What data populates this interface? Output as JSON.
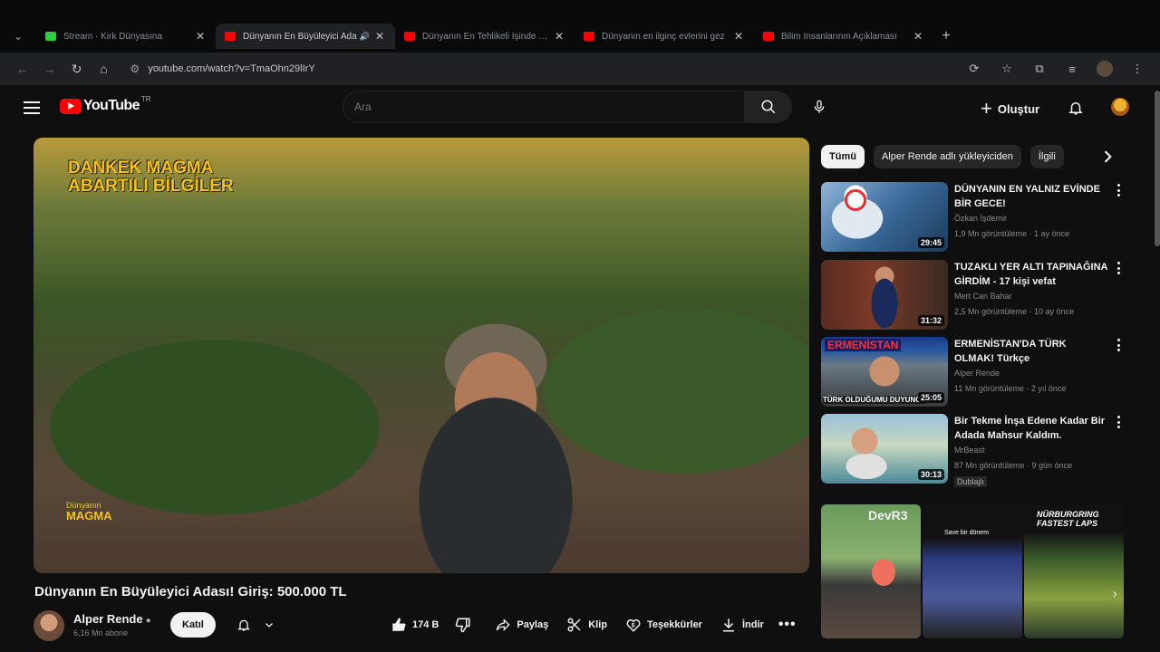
{
  "browser": {
    "tabs": [
      {
        "title": "Stream · Kirk Dünyasına",
        "active": false,
        "favicon_color": "#2ecc40"
      },
      {
        "title": "Dünyanın En Büyüleyici Ada",
        "active": true,
        "favicon_color": "#ff0000"
      },
      {
        "title": "Dünyanın En Tehlikeli İşinde Bir Gün",
        "active": false,
        "favicon_color": "#ff0000"
      },
      {
        "title": "Dünyanın en ilginç evlerini gez",
        "active": false,
        "favicon_color": "#ff0000"
      },
      {
        "title": "Bilim İnsanlarının Açıklaması",
        "active": false,
        "favicon_color": "#ff0000"
      }
    ],
    "url": "youtube.com/watch?v=TmaOhn29lIrY"
  },
  "header": {
    "logo_text": "YouTube",
    "country_code": "TR",
    "search_placeholder": "Ara",
    "create_label": "Oluştur"
  },
  "video": {
    "overlay_title_line1": "DANKEK MAGMA",
    "overlay_title_line2": "ABARTILI BİLGİLER",
    "overlay_caption_top": "Dünyanın",
    "overlay_caption_bottom": "MAGMA",
    "title": "Dünyanın En Büyüleyici Adası! Giriş: 500.000 TL"
  },
  "channel": {
    "name": "Alper Rende",
    "subscribers": "6,16 Mn abone",
    "join_label": "Katıl"
  },
  "actions": {
    "likes": "174 B",
    "share_label": "Paylaş",
    "clip_label": "Klip",
    "thanks_label": "Teşekkürler",
    "download_label": "İndir"
  },
  "chips": [
    "Tümü",
    "Alper Rende adlı yükleyiciden",
    "İlgili"
  ],
  "recommendations": [
    {
      "title": "DÜNYANIN EN YALNIZ EVİNDE BİR GECE!",
      "channel": "Özkan İşdemir",
      "meta": "1,9 Mn görüntüleme · 1 ay önce",
      "duration": "29:45",
      "dubbed": ""
    },
    {
      "title": "TUZAKLI YER ALTI TAPINAĞINA GİRDİM - 17 kişi vefat",
      "channel": "Mert Can Bahar",
      "meta": "2,5 Mn görüntüleme · 10 ay önce",
      "duration": "31:32",
      "dubbed": ""
    },
    {
      "title": "ERMENİSTAN'DA TÜRK OLMAK! Türkçe konuştuğumuzu duyan ...",
      "channel": "Alper Rende",
      "meta": "11 Mn görüntüleme · 2 yıl önce",
      "duration": "25:05",
      "dubbed": ""
    },
    {
      "title": "Bir Tekme İnşa Edene Kadar Bir Adada Mahsur Kaldım.",
      "channel": "MrBeast",
      "meta": "87 Mn görüntüleme · 9 gün önce",
      "duration": "30:13",
      "dubbed": "Dublajlı"
    }
  ],
  "shelf": {
    "label_a": "DevR3",
    "label_b": "Save bir dönem",
    "label_c": "NÜRBURGRING FASTEST LAPS"
  },
  "thumb_text": {
    "rec3_banner": "ERMENİSTAN",
    "rec3_caption": "TÜRK OLDUĞUMU DUYUNCA"
  }
}
